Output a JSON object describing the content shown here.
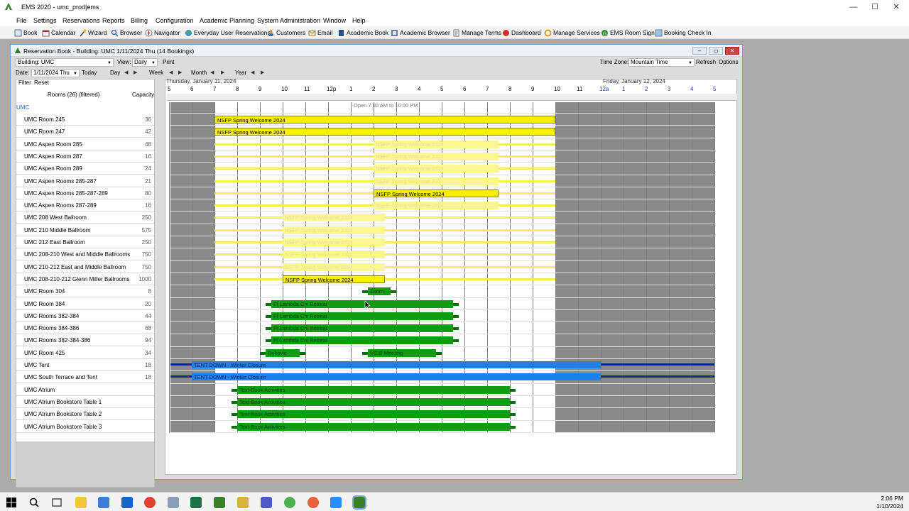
{
  "window": {
    "title": "EMS 2020 - umc_prod|ems",
    "minimize": "—",
    "maximize": "☐",
    "close": "✕"
  },
  "menu": [
    "File",
    "Settings",
    "Reservations",
    "Reports",
    "Billing",
    "Configuration",
    "Academic Planning",
    "System Administration",
    "Window",
    "Help"
  ],
  "toolbar": [
    {
      "label": "Book",
      "icon": "book-icon"
    },
    {
      "label": "Calendar",
      "icon": "calendar-icon"
    },
    {
      "label": "Wizard",
      "icon": "wizard-icon"
    },
    {
      "label": "Browser",
      "icon": "browser-icon"
    },
    {
      "label": "Navigator",
      "icon": "navigator-icon"
    },
    {
      "label": "Everyday User Reservations",
      "icon": "globe-icon"
    },
    {
      "label": "Customers",
      "icon": "customers-icon"
    },
    {
      "label": "Email",
      "icon": "email-icon"
    },
    {
      "label": "Academic Book",
      "icon": "academic-book-icon"
    },
    {
      "label": "Academic Browser",
      "icon": "academic-browser-icon"
    },
    {
      "label": "Manage Terms",
      "icon": "manage-terms-icon"
    },
    {
      "label": "Dashboard",
      "icon": "dashboard-icon"
    },
    {
      "label": "Manage Services",
      "icon": "manage-services-icon"
    },
    {
      "label": "EMS Room Sign",
      "icon": "room-sign-icon"
    },
    {
      "label": "Booking Check In",
      "icon": "check-in-icon"
    }
  ],
  "book": {
    "title": "Reservation Book - Building: UMC 1/11/2024 Thu (14 Bookings)",
    "building_label": "Building: UMC",
    "view_label": "View:",
    "view_value": "Daily",
    "print": "Print",
    "timezone_label": "Time Zone:",
    "timezone_value": "Mountain Time",
    "refresh": "Refresh",
    "options": "Options",
    "date_label": "Date:",
    "date_value": "1/11/2024 Thu",
    "today": "Today",
    "day": "Day",
    "week": "Week",
    "month": "Month",
    "year": "Year",
    "filter": "Filter",
    "reset": "Reset",
    "rooms_header": "Rooms (26) (filtered)",
    "capacity_header": "Capacity",
    "group": "UMC",
    "day1_label": "Thursday, January 11, 2024",
    "day2_label": "Friday, January 12, 2024",
    "open_note": "Open 7:00 AM to 10:00 PM",
    "hours": [
      "5",
      "6",
      "7",
      "8",
      "9",
      "10",
      "11",
      "12p",
      "1",
      "2",
      "3",
      "4",
      "5",
      "6",
      "7",
      "8",
      "9",
      "10",
      "11",
      "12a",
      "1",
      "2",
      "3",
      "4",
      "5"
    ]
  },
  "rooms": [
    {
      "name": "UMC Room 245",
      "cap": "36"
    },
    {
      "name": "UMC Room 247",
      "cap": "42"
    },
    {
      "name": "UMC Aspen Room 285",
      "cap": "48"
    },
    {
      "name": "UMC Aspen Room 287",
      "cap": "16"
    },
    {
      "name": "UMC Aspen Room 289",
      "cap": "24"
    },
    {
      "name": "UMC Aspen Rooms 285-287",
      "cap": "21"
    },
    {
      "name": "UMC Aspen Rooms 285-287-289",
      "cap": "80"
    },
    {
      "name": "UMC Aspen Rooms 287-289",
      "cap": "16"
    },
    {
      "name": "UMC 208 West Ballroom",
      "cap": "250"
    },
    {
      "name": "UMC 210 Middle Ballroom",
      "cap": "575"
    },
    {
      "name": "UMC 212 East Ballroom",
      "cap": "250"
    },
    {
      "name": "UMC 208-210 West and Middle Ballrooms",
      "cap": "750"
    },
    {
      "name": "UMC 210-212 East and Middle Ballroom",
      "cap": "750"
    },
    {
      "name": "UMC 208-210-212 Glenn Miller Ballrooms",
      "cap": "1000"
    },
    {
      "name": "UMC Room 304",
      "cap": "8"
    },
    {
      "name": "UMC Room 384",
      "cap": "20"
    },
    {
      "name": "UMC Rooms 382-384",
      "cap": "44"
    },
    {
      "name": "UMC Rooms 384-386",
      "cap": "68"
    },
    {
      "name": "UMC Rooms 382-384-386",
      "cap": "94"
    },
    {
      "name": "UMC Room 425",
      "cap": "34"
    },
    {
      "name": "UMC Tent",
      "cap": "18"
    },
    {
      "name": "UMC South Terrace and Tent",
      "cap": "18"
    },
    {
      "name": "UMC Atrium",
      "cap": ""
    },
    {
      "name": "UMC Atrium Bookstore Table 1",
      "cap": ""
    },
    {
      "name": "UMC Atrium Bookstore Table 2",
      "cap": ""
    },
    {
      "name": "UMC Atrium Bookstore Table 3",
      "cap": ""
    }
  ],
  "bookings": [
    {
      "room": 0,
      "start": "7:00",
      "end": "22:00",
      "style": "yel",
      "label": "NSFP Spring Welcome 2024"
    },
    {
      "room": 1,
      "start": "7:00",
      "end": "22:00",
      "style": "yel",
      "label": "NSFP Spring Welcome 2024"
    },
    {
      "room": 2,
      "start": "14:00",
      "end": "19:30",
      "style": "yel",
      "label": "NSFP Spring Welcome 2024",
      "faint": true
    },
    {
      "room": 3,
      "start": "14:00",
      "end": "19:30",
      "style": "yel",
      "label": "NSFP Spring Welcome 2024",
      "faint": true
    },
    {
      "room": 4,
      "start": "14:00",
      "end": "19:30",
      "style": "yel",
      "label": "NSFP Spring Welcome 2024",
      "faint": true
    },
    {
      "room": 5,
      "start": "14:00",
      "end": "19:30",
      "style": "yel",
      "label": "NSFP Spring Welcome 2024",
      "faint": true
    },
    {
      "room": 6,
      "start": "14:00",
      "end": "19:30",
      "style": "yel",
      "label": "NSFP Spring Welcome 2024"
    },
    {
      "room": 7,
      "start": "14:00",
      "end": "19:30",
      "style": "yel",
      "label": "NSFP Spring Welcome 2024",
      "faint": true
    },
    {
      "room": 8,
      "start": "10:00",
      "end": "14:30",
      "style": "yel",
      "label": "NSFP Spring Welcome 2024",
      "faint": true
    },
    {
      "room": 9,
      "start": "10:00",
      "end": "14:30",
      "style": "yel",
      "label": "NSFP Spring Welcome 2024",
      "faint": true
    },
    {
      "room": 10,
      "start": "10:00",
      "end": "14:30",
      "style": "yel",
      "label": "NSFP Spring Welcome 2024",
      "faint": true
    },
    {
      "room": 11,
      "start": "10:00",
      "end": "14:30",
      "style": "yel",
      "label": "NSFP Spring Welcome 2024",
      "faint": true
    },
    {
      "room": 12,
      "start": "10:00",
      "end": "14:30",
      "style": "yel",
      "label": "NSFP Spring Welcome 2024",
      "faint": true
    },
    {
      "room": 13,
      "start": "10:00",
      "end": "14:30",
      "style": "yel",
      "label": "NSFP Spring Welcome 2024"
    },
    {
      "room": 14,
      "start": "13:45",
      "end": "14:45",
      "style": "grn",
      "label": "Zoom"
    },
    {
      "room": 15,
      "start": "9:30",
      "end": "17:30",
      "style": "grn",
      "label": "Pi Lambda Chi Retreat"
    },
    {
      "room": 16,
      "start": "9:30",
      "end": "17:30",
      "style": "grn",
      "label": "Pi Lambda Chi Retreat"
    },
    {
      "room": 17,
      "start": "9:30",
      "end": "17:30",
      "style": "grn",
      "label": "Pi Lambda Chi Retreat"
    },
    {
      "room": 18,
      "start": "9:30",
      "end": "17:30",
      "style": "grn",
      "label": "Pi Lambda Chi Retreat"
    },
    {
      "room": 19,
      "start": "9:15",
      "end": "10:45",
      "style": "grn",
      "label": "Dukovic"
    },
    {
      "room": 19,
      "start": "13:45",
      "end": "16:45",
      "style": "grn",
      "label": "VCIS Meeting"
    },
    {
      "room": 20,
      "start": "6:00",
      "end": "0:00",
      "style": "blu",
      "label": "TENT DOWN - Winter Closure"
    },
    {
      "room": 21,
      "start": "6:00",
      "end": "0:00",
      "style": "blu",
      "label": "TENT DOWN - Winter Closure"
    },
    {
      "room": 22,
      "start": "8:00",
      "end": "20:00",
      "style": "grn",
      "label": "Text-Book Activities"
    },
    {
      "room": 23,
      "start": "8:00",
      "end": "20:00",
      "style": "grn",
      "label": "Text-Book Activities"
    },
    {
      "room": 24,
      "start": "8:00",
      "end": "20:00",
      "style": "grn",
      "label": "Text-Book Activities"
    },
    {
      "room": 25,
      "start": "8:00",
      "end": "20:00",
      "style": "grn",
      "label": "Text-Book Activities"
    }
  ],
  "taskbar": {
    "time": "2:06 PM",
    "date": "1/10/2024"
  }
}
